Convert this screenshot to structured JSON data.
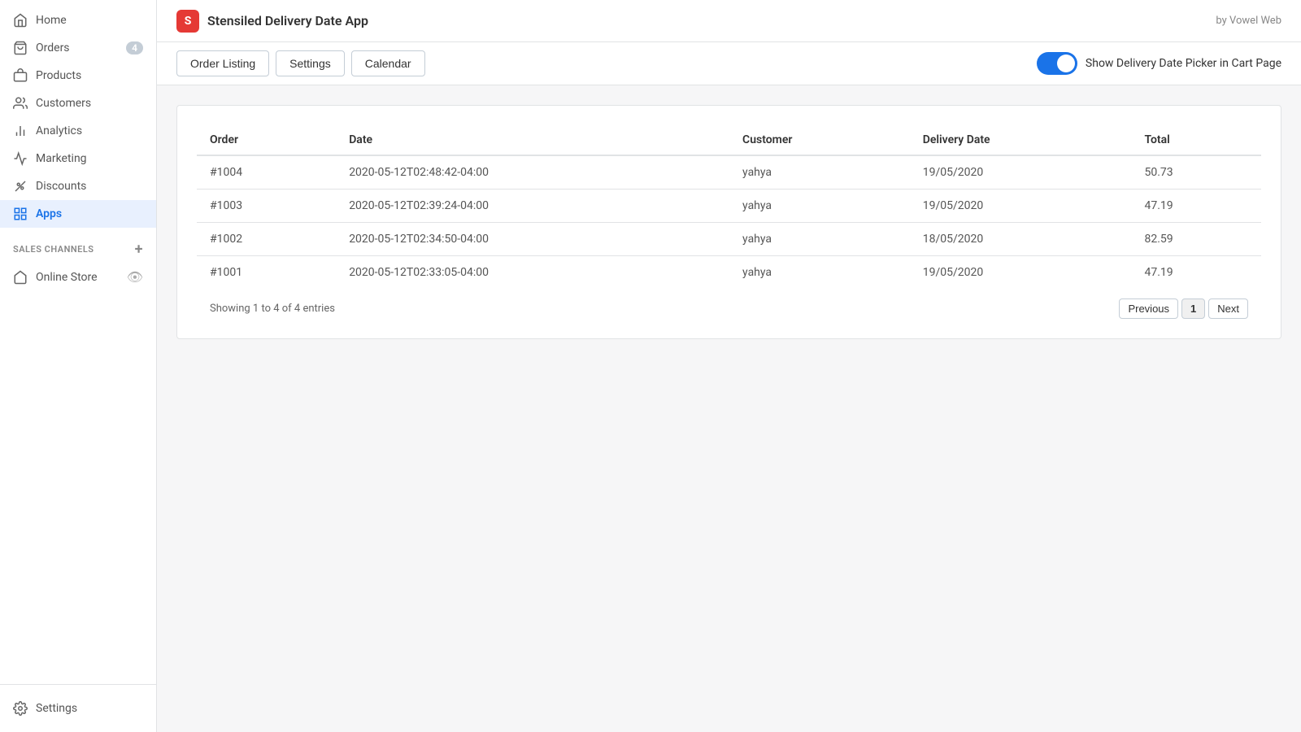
{
  "sidebar": {
    "items": [
      {
        "id": "home",
        "label": "Home",
        "icon": "home"
      },
      {
        "id": "orders",
        "label": "Orders",
        "icon": "orders",
        "badge": "4"
      },
      {
        "id": "products",
        "label": "Products",
        "icon": "products"
      },
      {
        "id": "customers",
        "label": "Customers",
        "icon": "customers"
      },
      {
        "id": "analytics",
        "label": "Analytics",
        "icon": "analytics"
      },
      {
        "id": "marketing",
        "label": "Marketing",
        "icon": "marketing"
      },
      {
        "id": "discounts",
        "label": "Discounts",
        "icon": "discounts"
      },
      {
        "id": "apps",
        "label": "Apps",
        "icon": "apps",
        "active": true
      }
    ],
    "sections": [
      {
        "id": "sales-channels",
        "label": "SALES CHANNELS",
        "items": [
          {
            "id": "online-store",
            "label": "Online Store",
            "icon": "store"
          }
        ]
      }
    ],
    "bottom": [
      {
        "id": "settings",
        "label": "Settings",
        "icon": "settings"
      }
    ]
  },
  "header": {
    "app_logo_text": "S",
    "app_title": "Stensiled Delivery Date App",
    "by_label": "by Vowel Web"
  },
  "toolbar": {
    "buttons": [
      {
        "id": "order-listing",
        "label": "Order Listing"
      },
      {
        "id": "settings",
        "label": "Settings"
      },
      {
        "id": "calendar",
        "label": "Calendar"
      }
    ],
    "toggle_label": "Show Delivery Date Picker in Cart Page",
    "toggle_on": true
  },
  "table": {
    "columns": [
      {
        "id": "order",
        "label": "Order"
      },
      {
        "id": "date",
        "label": "Date"
      },
      {
        "id": "customer",
        "label": "Customer"
      },
      {
        "id": "delivery_date",
        "label": "Delivery Date"
      },
      {
        "id": "total",
        "label": "Total"
      }
    ],
    "rows": [
      {
        "order": "#1004",
        "date": "2020-05-12T02:48:42-04:00",
        "customer": "yahya",
        "delivery_date": "19/05/2020",
        "total": "50.73"
      },
      {
        "order": "#1003",
        "date": "2020-05-12T02:39:24-04:00",
        "customer": "yahya",
        "delivery_date": "19/05/2020",
        "total": "47.19"
      },
      {
        "order": "#1002",
        "date": "2020-05-12T02:34:50-04:00",
        "customer": "yahya",
        "delivery_date": "18/05/2020",
        "total": "82.59"
      },
      {
        "order": "#1001",
        "date": "2020-05-12T02:33:05-04:00",
        "customer": "yahya",
        "delivery_date": "19/05/2020",
        "total": "47.19"
      }
    ]
  },
  "pagination": {
    "showing_text": "Showing 1 to 4 of 4 entries",
    "previous_label": "Previous",
    "next_label": "Next",
    "current_page": "1"
  }
}
